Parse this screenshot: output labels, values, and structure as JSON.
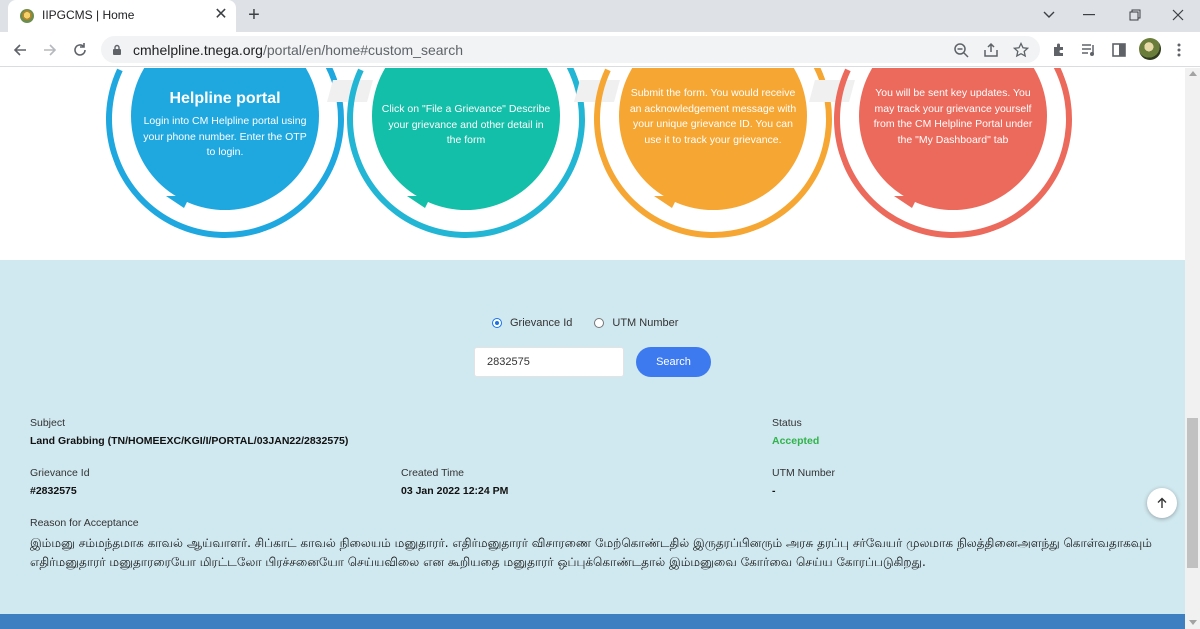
{
  "browser": {
    "tab_title": "IIPGCMS | Home",
    "url_host": "cmhelpline.tnega.org",
    "url_path": "/portal/en/home#custom_search"
  },
  "steps": [
    {
      "heading": "Helpline portal",
      "text": "Login into CM Helpline portal using your phone number. Enter the OTP to login.",
      "color": "#1fa8e0",
      "ring_color": "#1fa8e0"
    },
    {
      "heading": "",
      "text": "Click on \"File a Grievance\" Describe your grievance and other detail in the form",
      "color": "#13bfa8",
      "ring_color": "#23b6d4"
    },
    {
      "heading": "",
      "text": "Submit the form. You would receive an acknowledgement message with your unique grievance ID. You can use it to track your grievance.",
      "color": "#f6a632",
      "ring_color": "#f6a632"
    },
    {
      "heading": "",
      "text": "You will be sent key updates. You may track your grievance yourself from the CM Helpline Portal under the \"My Dashboard\" tab",
      "color": "#ec6a5c",
      "ring_color": "#ec6a5c"
    }
  ],
  "search": {
    "option_grievance": "Grievance Id",
    "option_utm": "UTM Number",
    "selected": "Grievance Id",
    "input_value": "2832575",
    "button_label": "Search"
  },
  "result": {
    "subject_label": "Subject",
    "subject_value": "Land Grabbing (TN/HOMEEXC/KGI/I/PORTAL/03JAN22/2832575)",
    "status_label": "Status",
    "status_value": "Accepted",
    "status_color": "#2fb34a",
    "grievance_id_label": "Grievance Id",
    "grievance_id_value": "#2832575",
    "created_time_label": "Created Time",
    "created_time_value": "03 Jan 2022 12:24 PM",
    "utm_label": "UTM Number",
    "utm_value": "-",
    "reason_label": "Reason for Acceptance",
    "reason_text": "இம்மனு சம்மந்தமாக காவல் ஆய்வாளர். சிப்காட் காவல் நிலையம் மனுதாரர். எதிர்மனுதாரர் விசாரணை மேற்கொண்டதில் இருதரப்பினரும் அரசு தரப்பு சர்வேயர் முலமாக நிலத்தினைஅளந்து கொள்வதாகவும் எதிர்மனுதாரர் மனுதாரரையோ மிரட்டலோ பிரச்சனையோ செய்யவிலை என கூறியதை மனுதாரர் ஒப்புக்கொண்டதால் இம்மனுவை கோர்வை செய்ய கோரப்படுகிறது."
  },
  "icons": {
    "favicon": "tn-emblem-icon",
    "back": "arrow-left-icon",
    "forward": "arrow-right-icon",
    "reload": "reload-icon",
    "lock": "lock-icon",
    "zoom": "zoom-icon",
    "share": "share-icon",
    "star": "star-icon",
    "extensions": "puzzle-icon",
    "media": "media-queue-icon",
    "sidepanel": "side-panel-icon",
    "menu": "kebab-menu-icon",
    "scroll_top": "arrow-up-icon"
  }
}
